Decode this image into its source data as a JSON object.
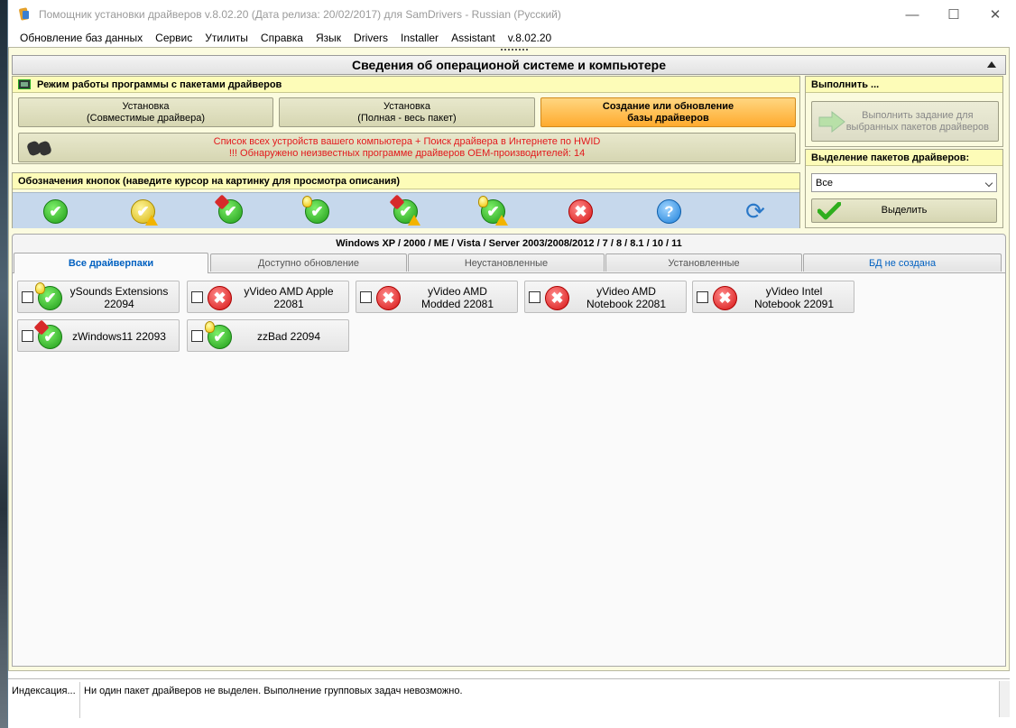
{
  "window": {
    "title": "Помощник установки драйверов v.8.02.20 (Дата релиза: 20/02/2017) для SamDrivers - Russian (Русский)",
    "controls": {
      "minimize": "—",
      "maximize": "☐",
      "close": "✕"
    }
  },
  "menu": [
    "Обновление баз данных",
    "Сервис",
    "Утилиты",
    "Справка",
    "Язык",
    "Drivers",
    "Installer",
    "Assistant",
    "v.8.02.20"
  ],
  "header": {
    "title": "Сведения об операционой системе и компьютере"
  },
  "mode_panel": {
    "title": "Режим работы программы с пакетами драйверов",
    "buttons": [
      {
        "line1": "Установка",
        "line2": "(Совместимые драйвера)"
      },
      {
        "line1": "Установка",
        "line2": "(Полная - весь пакет)"
      },
      {
        "line1": "Создание или обновление",
        "line2": "базы драйверов"
      }
    ],
    "devices_line1": "Список всех устройств вашего компьютера + Поиск драйвера в Интернете по HWID",
    "devices_line2": "!!! Обнаружено неизвестных программе драйверов OEM-производителей: 14"
  },
  "execute_panel": {
    "title": "Выполнить ...",
    "button_line1": "Выполнить задание для",
    "button_line2": "выбранных пакетов драйверов"
  },
  "legend_panel": {
    "title": "Обозначения кнопок (наведите курсор на картинку для просмотра описания)",
    "icons": [
      "green-check-icon",
      "yellow-check-warning-icon",
      "pin-check-icon",
      "bulb-check-icon",
      "pin-check-warning-icon",
      "bulb-check-warning-icon",
      "red-cross-icon",
      "blue-question-icon",
      "refresh-arrows-icon"
    ]
  },
  "select_panel": {
    "title": "Выделение пакетов драйверов:",
    "selected": "Все",
    "button": "Выделить"
  },
  "tabs_area": {
    "os_title": "Windows XP / 2000 / ME / Vista / Server 2003/2008/2012 / 7 / 8 / 8.1 / 10 / 11",
    "tabs": [
      "Все драйверпаки",
      "Доступно обновление",
      "Неустановленные",
      "Установленные",
      "БД не создана"
    ]
  },
  "packs": [
    {
      "line1": "ySounds Extensions",
      "line2": "22094",
      "icon": "bulb-green-check-icon"
    },
    {
      "line1": "yVideo AMD Apple",
      "line2": "22081",
      "icon": "red-cross-icon"
    },
    {
      "line1": "yVideo AMD",
      "line2": "Modded 22081",
      "icon": "red-cross-icon"
    },
    {
      "line1": "yVideo AMD",
      "line2": "Notebook 22081",
      "icon": "red-cross-icon"
    },
    {
      "line1": "yVideo Intel",
      "line2": "Notebook 22091",
      "icon": "red-cross-icon"
    },
    {
      "line1": "zWindows11 22093",
      "line2": "",
      "icon": "pin-green-check-icon"
    },
    {
      "line1": "zzBad 22094",
      "line2": "",
      "icon": "bulb-green-check-icon"
    }
  ],
  "status": {
    "left": "Индексация...",
    "message": "Ни один пакет драйверов не выделен. Выполнение групповых задач невозможно."
  }
}
